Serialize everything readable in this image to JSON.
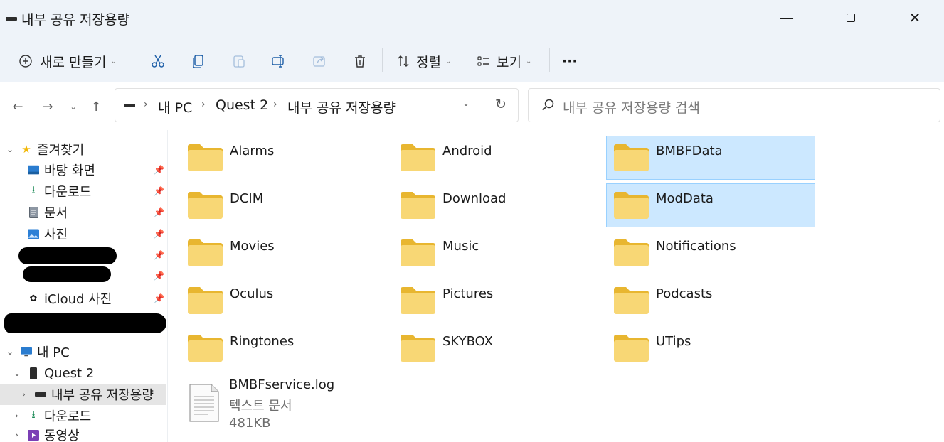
{
  "window": {
    "title": "내부 공유 저장용량",
    "minimize": "—",
    "close": "✕"
  },
  "toolbar": {
    "new_label": "새로 만들기",
    "sort_label": "정렬",
    "view_label": "보기",
    "more_label": "···"
  },
  "address": {
    "crumbs": [
      "내 PC",
      "Quest 2",
      "내부 공유 저장용량"
    ],
    "separator": "›"
  },
  "search": {
    "placeholder": "내부 공유 저장용량 검색"
  },
  "sidebar": {
    "favorites": "즐겨찾기",
    "items": [
      "바탕 화면",
      "다운로드",
      "문서",
      "사진",
      "iCloud 사진"
    ],
    "this_pc": "내 PC",
    "quest": "Quest 2",
    "storage": "내부 공유 저장용량",
    "downloads": "다운로드",
    "videos": "동영상"
  },
  "folders": [
    [
      "Alarms",
      "Android",
      "BMBFData"
    ],
    [
      "DCIM",
      "Download",
      "ModData"
    ],
    [
      "Movies",
      "Music",
      "Notifications"
    ],
    [
      "Oculus",
      "Pictures",
      "Podcasts"
    ],
    [
      "Ringtones",
      "SKYBOX",
      "UTips"
    ]
  ],
  "file": {
    "name": "BMBFservice.log",
    "type": "텍스트 문서",
    "size": "481KB"
  },
  "colors": {
    "chrome": "#eef3f9",
    "selection": "#cce8ff",
    "selection_border": "#99d1ff",
    "folder": "#f8d775"
  }
}
